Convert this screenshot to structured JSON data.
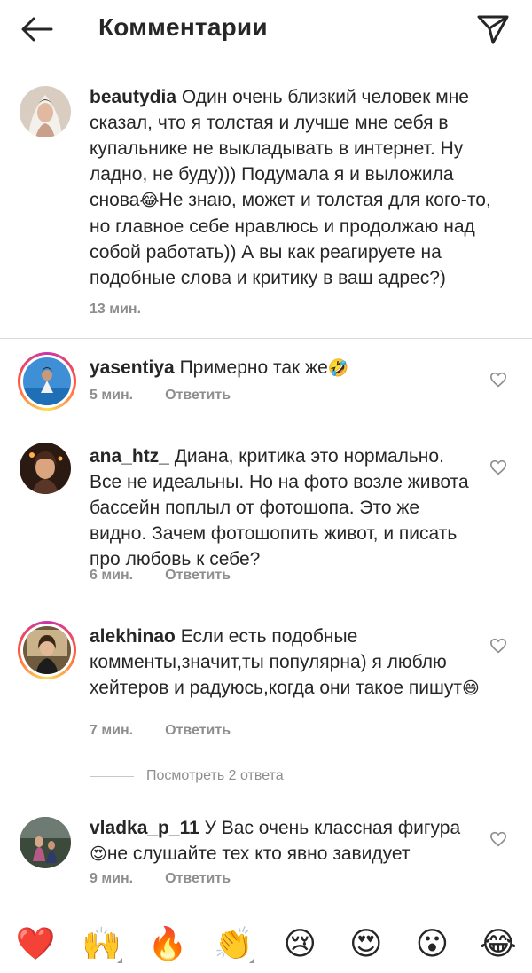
{
  "header": {
    "title": "Комментарии",
    "back_icon": "arrow-left-icon",
    "send_icon": "paper-plane-icon"
  },
  "caption": {
    "username": "beautydia",
    "text_part1": " Один очень близкий человек мне сказал, что я толстая и лучше мне себя в купальнике не выкладывать в интернет. Ну ладно, не буду))) Подумала я и выложила снова",
    "emoji1": "😂",
    "text_part2": "Не знаю, может и толстая для кого-то, но главное себе нравлюсь и продолжаю над собой работать)) А вы как реагируете на подобные слова и критику в ваш адрес?)",
    "time": "13 мин."
  },
  "comments": [
    {
      "username": "yasentiya",
      "text": " Примерно так же",
      "emoji": "🤣",
      "time": "5 мин.",
      "reply": "Ответить"
    },
    {
      "username": "ana_htz_",
      "text": " Диана, критика это нормально. Все не идеальны. Но на фото возле живота бассейн поплыл от фотошопа. Это же видно. Зачем фотошопить живот, и писать про любовь к себе?",
      "emoji": "",
      "time": "6 мин.",
      "reply": "Ответить"
    },
    {
      "username": "alekhinao",
      "text": " Если есть подобные комменты,значит,ты популярна) я люблю хейтеров и радуюсь,когда они такое пишут",
      "emoji": "😄",
      "time": "7 мин.",
      "reply": "Ответить"
    },
    {
      "username": "vladka_p_11",
      "text": " У Вас очень классная фигура ",
      "emoji": "😍",
      "text_after": "не слушайте тех кто явно завидует",
      "time": "9 мин.",
      "reply": "Ответить"
    }
  ],
  "view_replies": "Посмотреть 2 ответа",
  "emoji_bar": [
    "❤️",
    "🙌",
    "🔥",
    "👏",
    "😢",
    "😍",
    "😮",
    "😂"
  ],
  "colors": {
    "text": "#262626",
    "muted": "#8e8e8e",
    "divider": "#dbdbdb"
  }
}
